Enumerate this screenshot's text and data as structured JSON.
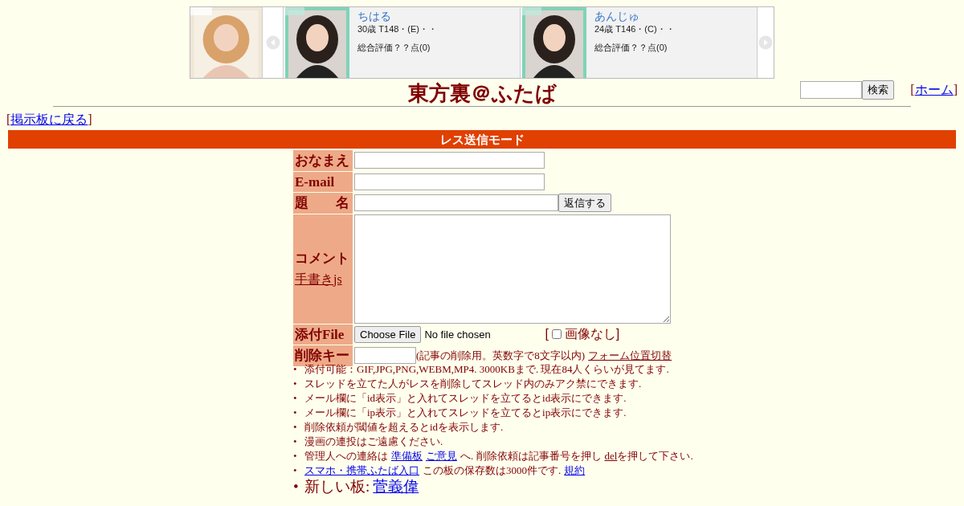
{
  "banner": {
    "items": [
      {
        "name": "ちはる",
        "info": "30歳 T148・(E)・・",
        "rating": "総合評価？？点(0)"
      },
      {
        "name": "あんじゅ",
        "info": "24歳 T146・(C)・・",
        "rating": "総合評価？？点(0)"
      }
    ]
  },
  "title": "東方裏＠ふたば",
  "search": {
    "button": "検索"
  },
  "home": {
    "open": "[",
    "link": "ホーム",
    "close": "]"
  },
  "back": {
    "open": "[",
    "link": "掲示板に戻る",
    "close": "]"
  },
  "mode_bar": "レス送信モード",
  "form": {
    "rows": [
      {
        "kind": "text",
        "label": "おなまえ"
      },
      {
        "kind": "text",
        "label": "E-mail"
      },
      {
        "kind": "subject",
        "label": "題　　名",
        "button": "返信する"
      },
      {
        "kind": "comment",
        "label": "コメント",
        "link": "手書きjs"
      },
      {
        "kind": "file",
        "label": "添付File",
        "button": "Choose File",
        "status": "No file chosen",
        "open": "[",
        "check_label": "画像なし",
        "close": "]",
        "checked": false
      },
      {
        "kind": "delkey",
        "label": "削除キー",
        "note": "(記事の削除用。英数字で8文字以内)",
        "link": "フォーム位置切替"
      }
    ]
  },
  "marker": "•",
  "notes": [
    {
      "big": false,
      "parts": [
        {
          "kind": "text",
          "text": "添付可能：GIF,JPG,PNG,WEBM,MP4. 3000KBまで. 現在84人くらいが見てます."
        }
      ]
    },
    {
      "big": false,
      "parts": [
        {
          "kind": "text",
          "text": "スレッドを立てた人がレスを削除してスレッド内のみアク禁にできます."
        }
      ]
    },
    {
      "big": false,
      "parts": [
        {
          "kind": "text",
          "text": "メール欄に「id表示」と入れてスレッドを立てるとid表示にできます."
        }
      ]
    },
    {
      "big": false,
      "parts": [
        {
          "kind": "text",
          "text": "メール欄に「ip表示」と入れてスレッドを立てるとip表示にできます."
        }
      ]
    },
    {
      "big": false,
      "parts": [
        {
          "kind": "text",
          "text": "削除依頼が閾値を超えるとidを表示します."
        }
      ]
    },
    {
      "big": false,
      "parts": [
        {
          "kind": "text",
          "text": "漫画の連投はご遠慮ください."
        }
      ]
    },
    {
      "big": false,
      "parts": [
        {
          "kind": "text",
          "text": "管理人への連絡は"
        },
        {
          "kind": "link",
          "text": "準備板"
        },
        {
          "kind": "link",
          "text": "ご意見"
        },
        {
          "kind": "text",
          "text": "へ. 削除依頼は記事番号を押し"
        },
        {
          "kind": "dellink",
          "text": "del"
        },
        {
          "kind": "text",
          "text": "を押して下さい."
        }
      ]
    },
    {
      "big": false,
      "parts": [
        {
          "kind": "link",
          "text": "スマホ・携帯ふたば入口"
        },
        {
          "kind": "text",
          "text": "この板の保存数は3000件です."
        },
        {
          "kind": "link",
          "text": "規約"
        }
      ]
    },
    {
      "big": true,
      "parts": [
        {
          "kind": "text",
          "text": "新しい板:"
        },
        {
          "kind": "link",
          "text": "菅義偉"
        }
      ]
    }
  ]
}
